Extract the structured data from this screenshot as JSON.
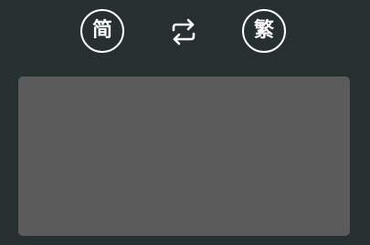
{
  "toolbar": {
    "simplified_label": "简",
    "traditional_label": "繁",
    "swap_icon": "swap-arrows-icon"
  },
  "editor": {
    "value": "",
    "placeholder": ""
  },
  "colors": {
    "background": "#263030",
    "text_area": "#5b5b5b",
    "foreground": "#ffffff"
  }
}
